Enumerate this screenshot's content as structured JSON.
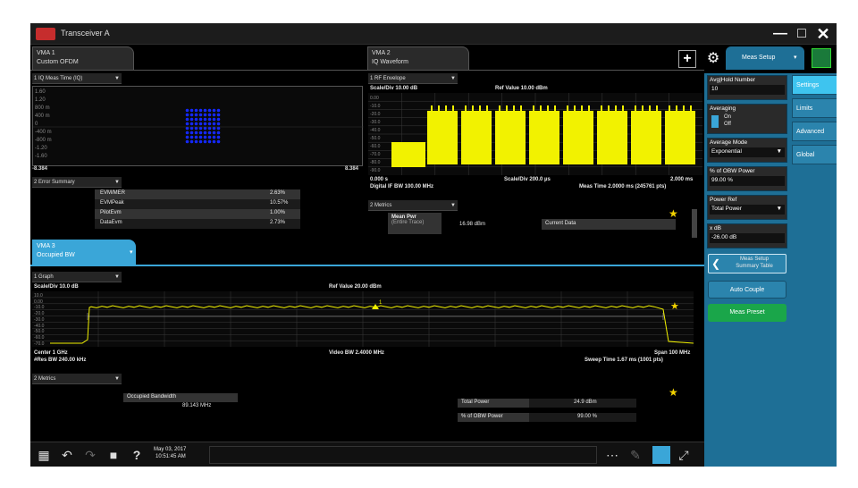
{
  "window": {
    "title": "Transceiver A"
  },
  "tabs": {
    "vma1_line1": "VMA 1",
    "vma1_line2": "Custom OFDM",
    "vma2_line1": "VMA 2",
    "vma2_line2": "IQ Waveform",
    "vma3_line1": "VMA 3",
    "vma3_line2": "Occupied BW"
  },
  "toolbar": {
    "add": "+",
    "meas_setup": "Meas Setup"
  },
  "iq": {
    "dropdown": "1 IQ Meas Time (IQ)",
    "y_ticks": [
      "1.60",
      "1.20",
      "800 m",
      "400 m",
      "0",
      "-400 m",
      "-800 m",
      "-1.20",
      "-1.60"
    ],
    "x_left": "-8.384",
    "x_right": "8.384"
  },
  "errors": {
    "dropdown": "2 Error Summary",
    "rows": [
      {
        "label": "EVM/MER",
        "value": "2.63%"
      },
      {
        "label": "EVMPeak",
        "value": "10.57%"
      },
      {
        "label": "PilotEvm",
        "value": "1.00%"
      },
      {
        "label": "DataEvm",
        "value": "2.73%"
      }
    ]
  },
  "rf_env": {
    "dropdown": "1 RF Envelope",
    "scale": "Scale/Div 10.00 dB",
    "ref": "Ref Value 10.00 dBm",
    "y_ticks": [
      "0.00",
      "-10.0",
      "-20.0",
      "-30.0",
      "-40.0",
      "-50.0",
      "-60.0",
      "-70.0",
      "-80.0",
      "-90.0"
    ],
    "x_start": "0.000 s",
    "x_scale": "Scale/Div 200.0 µs",
    "x_end": "2.000 ms",
    "digital_bw": "Digital IF BW 100.00 MHz",
    "meas_time": "Meas Time 2.0000 ms (245761 pts)"
  },
  "metrics_top": {
    "dropdown": "2 Metrics",
    "label_line1": "Mean Pwr",
    "label_line2": "(Entire Trace)",
    "value": "16.98 dBm",
    "current": "Current Data"
  },
  "obw_graph": {
    "dropdown": "1 Graph",
    "scale": "Scale/Div 10.0 dB",
    "ref": "Ref Value 20.00 dBm",
    "y_ticks": [
      "10.0",
      "0.00",
      "-10.0",
      "-20.0",
      "-30.0",
      "-40.0",
      "-50.0",
      "-60.0",
      "-70.0"
    ],
    "marker": "1",
    "center": "Center 1 GHz",
    "res_bw": "#Res BW 240.00 kHz",
    "video_bw": "Video BW 2.4000 MHz",
    "span": "Span 100 MHz",
    "sweep": "Sweep Time 1.67 ms (1001 pts)"
  },
  "obw_metrics": {
    "dropdown": "2 Metrics",
    "occ_label": "Occupied Bandwidth",
    "occ_value": "89.143 MHz",
    "total_power_label": "Total Power",
    "total_power_value": "24.9 dBm",
    "pct_obw_label": "% of OBW Power",
    "pct_obw_value": "99.00 %"
  },
  "meas_setup_panel": {
    "avg_label": "Avg|Hold Number",
    "avg_value": "10",
    "averaging_label": "Averaging",
    "averaging_on": "On",
    "averaging_off": "Off",
    "avg_mode_label": "Average Mode",
    "avg_mode_value": "Exponential",
    "pct_obw_label": "% of OBW Power",
    "pct_obw_value": "99.00 %",
    "power_ref_label": "Power Ref",
    "power_ref_value": "Total Power",
    "xdb_label": "x dB",
    "xdb_value": "-26.00 dB",
    "summary_line1": "Meas Setup",
    "summary_line2": "Summary Table",
    "auto_couple": "Auto Couple",
    "meas_preset": "Meas Preset"
  },
  "side_tabs": [
    "Settings",
    "Limits",
    "Advanced",
    "Global"
  ],
  "taskbar": {
    "date": "May 03, 2017",
    "time": "10:51:45 AM",
    "help": "?"
  },
  "colors": {
    "trace": "#f2f200",
    "constellation": "#1428ff",
    "accent": "#3aa6d8",
    "preset": "#1aa64a",
    "window_logo": "#c62d2d"
  }
}
